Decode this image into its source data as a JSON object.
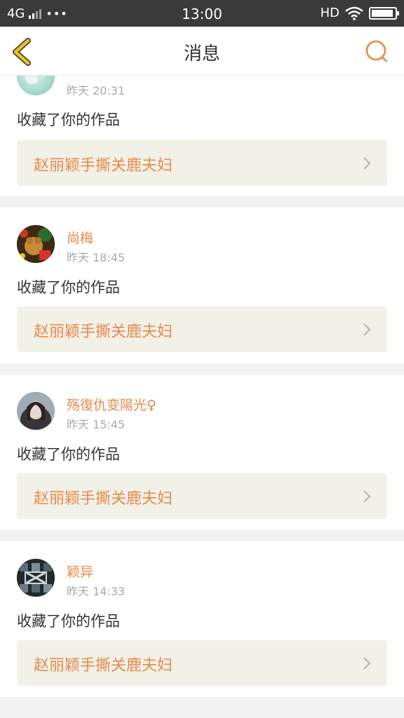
{
  "status_bar": {
    "network": "4G",
    "dots": "•••",
    "time": "13:00",
    "hd": "HD",
    "battery_level": 0.95
  },
  "nav": {
    "title": "消息",
    "back_icon": "chevron-left-icon",
    "search_icon": "search-icon"
  },
  "colors": {
    "accent": "#e8894a",
    "back_icon": "#f3c21a",
    "work_bg": "#f1f1e8"
  },
  "messages": [
    {
      "name": "",
      "time": "昨天 20:31",
      "action": "收藏了你的作品",
      "work_title": "赵丽颖手撕关鹿夫妇"
    },
    {
      "name": "尚梅",
      "time": "昨天 18:45",
      "action": "收藏了你的作品",
      "work_title": "赵丽颖手撕关鹿夫妇"
    },
    {
      "name": "殇復仇变陽光♀",
      "time": "昨天 15:45",
      "action": "收藏了你的作品",
      "work_title": "赵丽颖手撕关鹿夫妇"
    },
    {
      "name": "颖异",
      "time": "昨天 14:33",
      "action": "收藏了你的作品",
      "work_title": "赵丽颖手撕关鹿夫妇"
    }
  ]
}
